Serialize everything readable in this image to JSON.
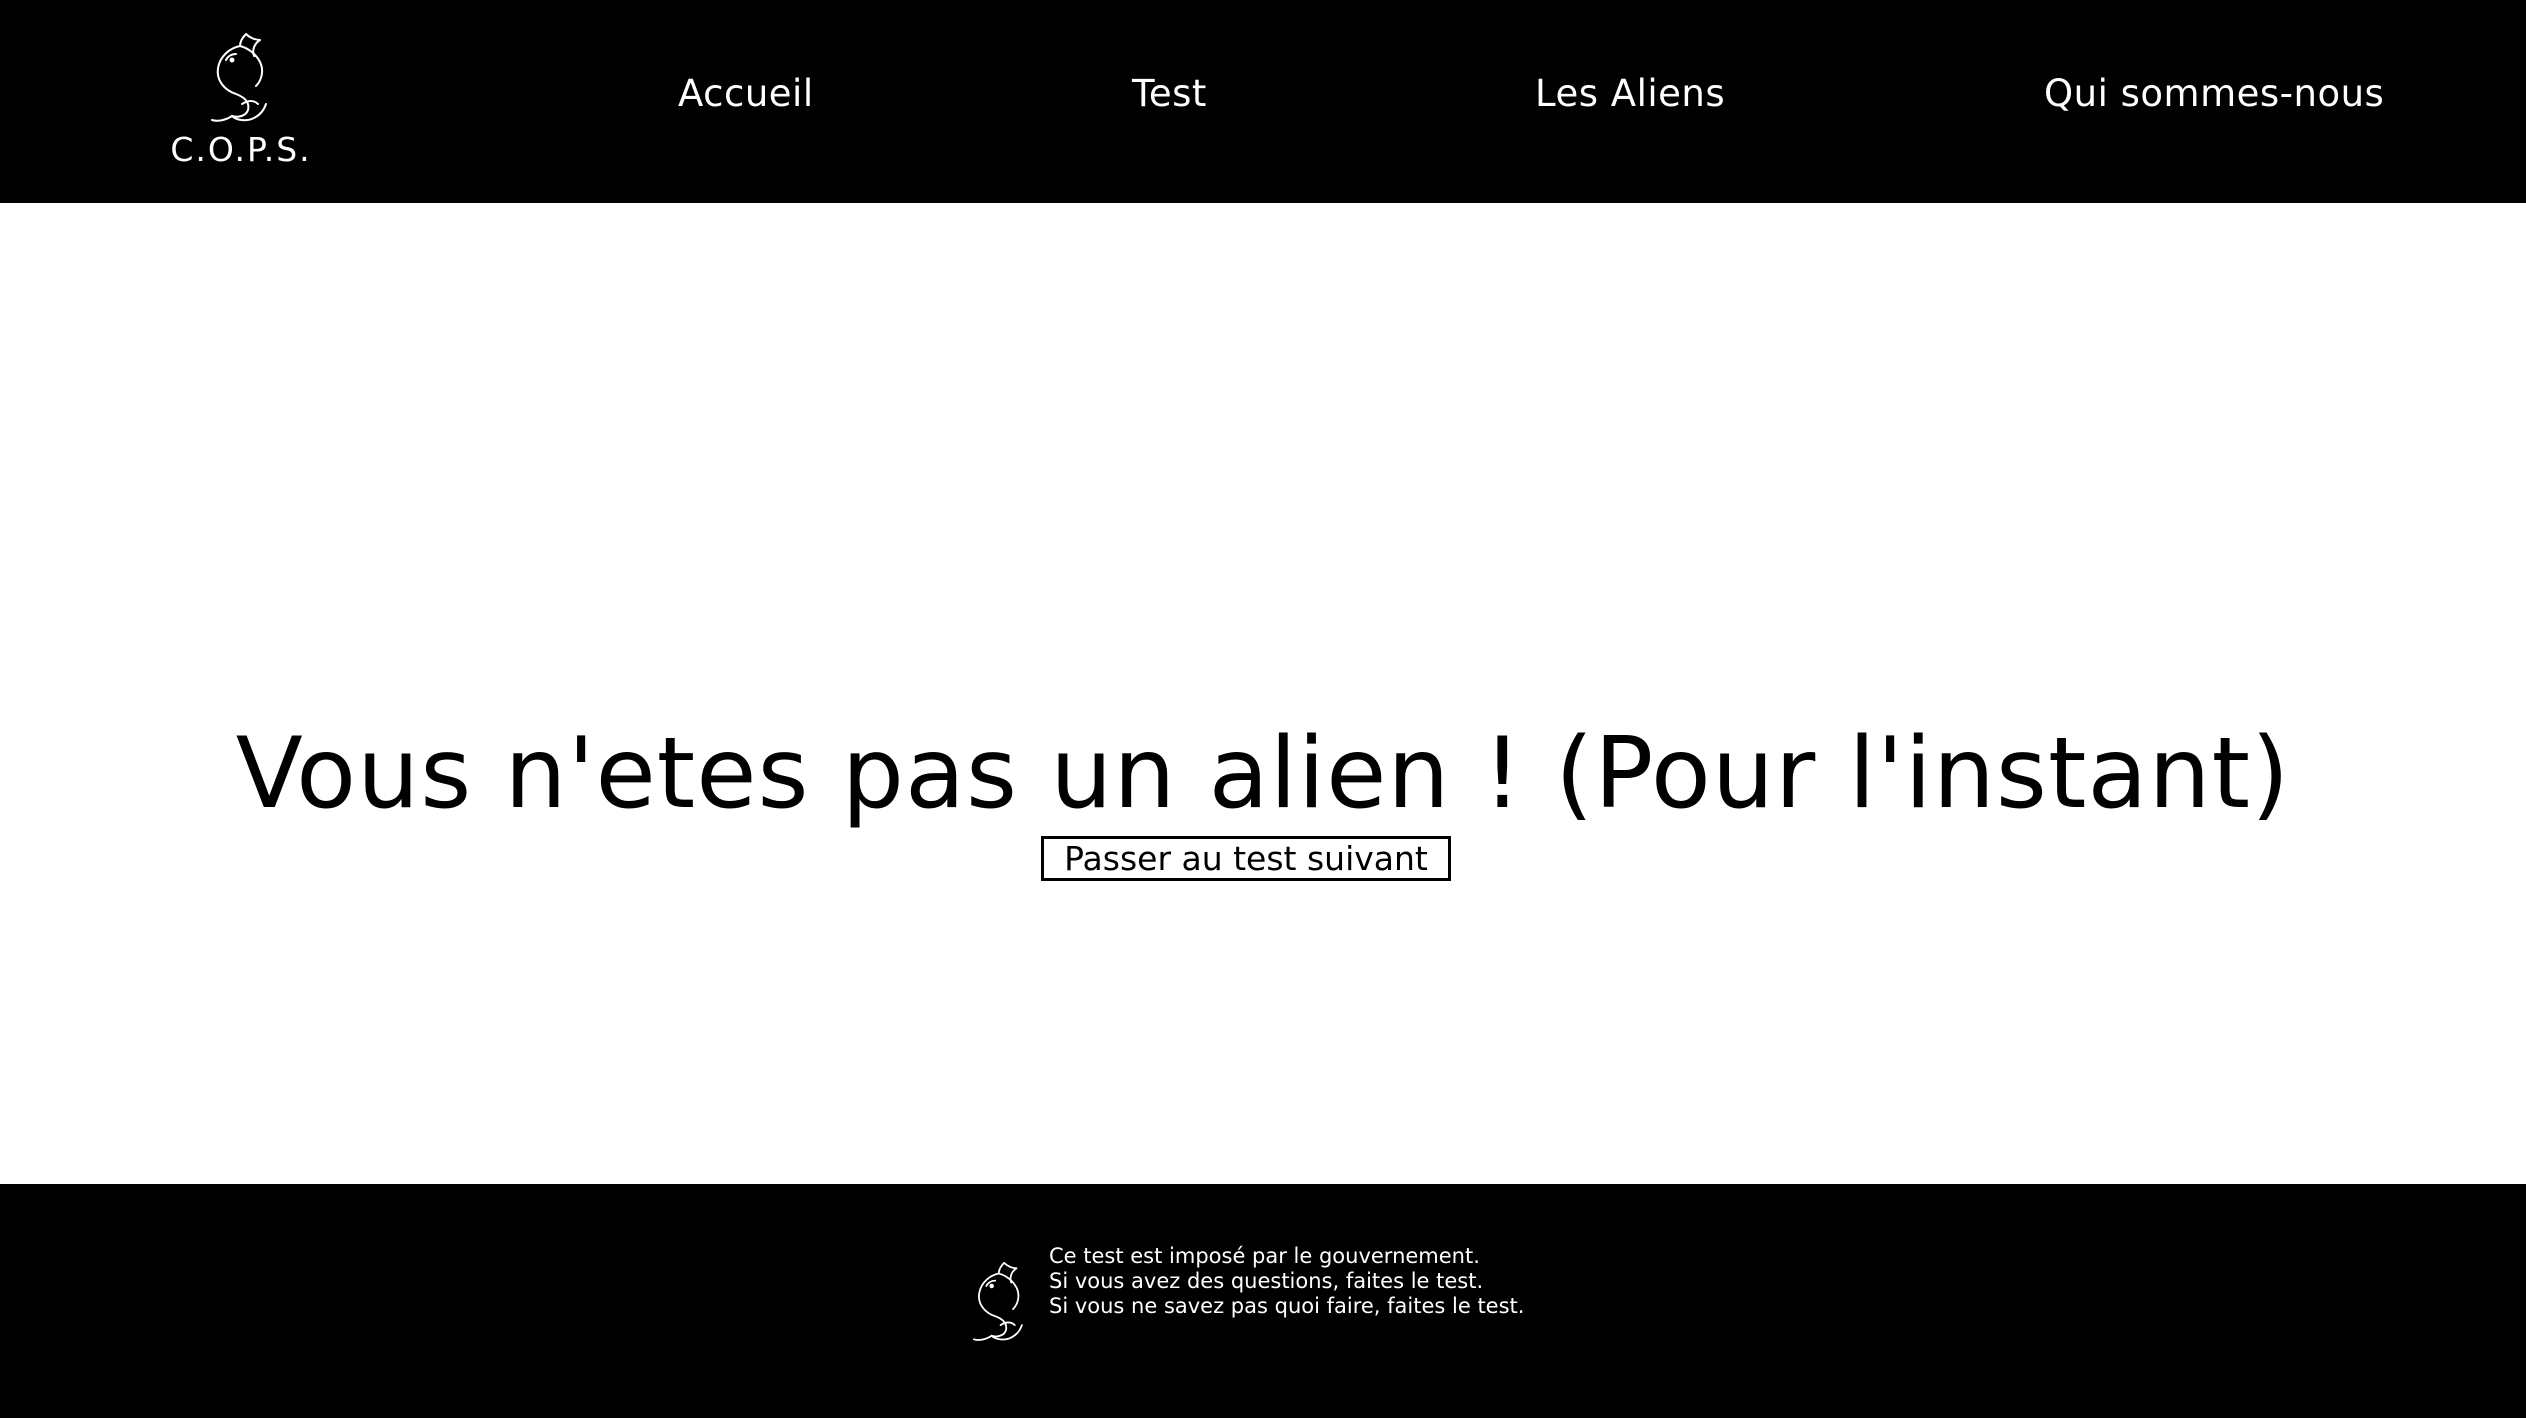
{
  "colors": {
    "header_bg": "#000000",
    "footer_bg": "#000000",
    "page_bg": "#ffffff",
    "text_light": "#ffffff",
    "text_dark": "#000000"
  },
  "header": {
    "brand_name": "C.O.P.S.",
    "logo_icon": "dolphin-icon",
    "nav": [
      {
        "label": "Accueil"
      },
      {
        "label": "Test"
      },
      {
        "label": "Les Aliens"
      },
      {
        "label": "Qui sommes-nous"
      }
    ]
  },
  "main": {
    "result_title": "Vous n'etes pas un alien ! (Pour l'instant)",
    "next_button_label": "Passer au test suivant"
  },
  "footer": {
    "logo_icon": "dolphin-icon",
    "lines": [
      "Ce test est imposé par le gouvernement.",
      "Si vous avez des questions, faites le test.",
      "Si vous ne savez pas quoi faire, faites le test."
    ]
  }
}
